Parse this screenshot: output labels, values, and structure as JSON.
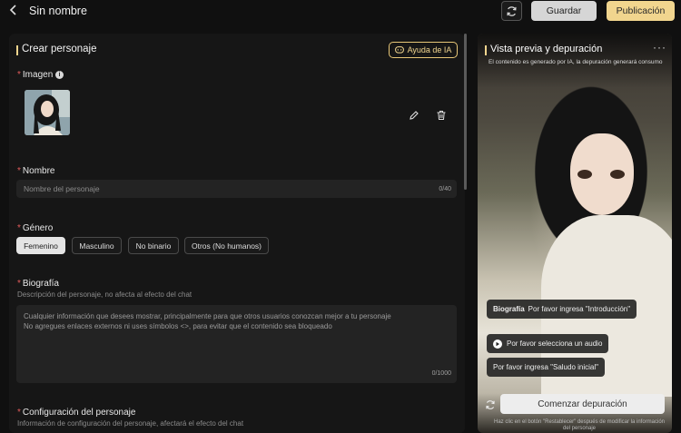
{
  "header": {
    "title": "Sin nombre",
    "save_label": "Guardar",
    "publish_label": "Publicación"
  },
  "form": {
    "title": "Crear personaje",
    "ai_help_label": "Ayuda de IA",
    "image": {
      "label": "Imagen"
    },
    "name": {
      "label": "Nombre",
      "placeholder": "Nombre del personaje",
      "counter": "0/40"
    },
    "gender": {
      "label": "Género",
      "options": [
        "Femenino",
        "Masculino",
        "No binario",
        "Otros (No humanos)"
      ],
      "selected": "Femenino"
    },
    "bio": {
      "label": "Biografía",
      "description": "Descripción del personaje, no afecta al efecto del chat",
      "placeholder_line1": "Cualquier información que desees mostrar, principalmente para que otros usuarios conozcan mejor a tu personaje",
      "placeholder_line2": "No agregues enlaces externos ni uses símbolos <>, para evitar que el contenido sea bloqueado",
      "counter": "0/1000"
    },
    "config": {
      "label": "Configuración del personaje",
      "description": "Información de configuración del personaje, afectará el efecto del chat"
    }
  },
  "preview": {
    "title": "Vista previa y depuración",
    "more": "···",
    "note": "El contenido es generado por IA, la depuración generará consumo",
    "bio_label": "Biografía",
    "bio_prompt": "Por favor ingresa \"Introducción\"",
    "audio_prompt": "Por favor selecciona un audio",
    "greeting_prompt": "Por favor ingresa \"Saludo inicial\"",
    "start_label": "Comenzar depuración",
    "footer": "Haz clic en el botón \"Restablecer\" después de modificar la información del personaje"
  },
  "colors": {
    "accent": "#f1d58e",
    "required": "#e05b5b",
    "background": "#101010",
    "panel": "#161616"
  }
}
